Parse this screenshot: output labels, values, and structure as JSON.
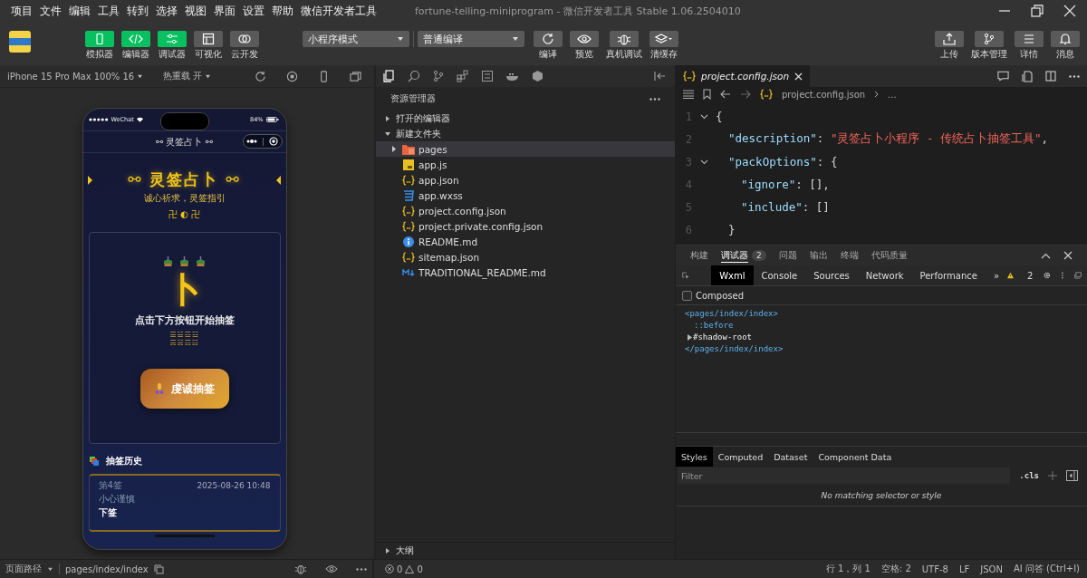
{
  "window": {
    "title": "fortune-telling-miniprogram - 微信开发者工具 Stable 1.06.2504010"
  },
  "menu": [
    "项目",
    "文件",
    "编辑",
    "工具",
    "转到",
    "选择",
    "视图",
    "界面",
    "设置",
    "帮助",
    "微信开发者工具"
  ],
  "toolbar": {
    "view_toggles": [
      {
        "label": "模拟器",
        "kind": "phone",
        "on": true
      },
      {
        "label": "编辑器",
        "kind": "code",
        "on": true
      },
      {
        "label": "调试器",
        "kind": "sliders",
        "on": true
      },
      {
        "label": "可视化",
        "kind": "layout",
        "on": false
      },
      {
        "label": "云开发",
        "kind": "cloud",
        "on": false
      }
    ],
    "mode_select": "小程序模式",
    "compile_select": "普通编译",
    "actions": [
      {
        "label": "编译",
        "kind": "refresh"
      },
      {
        "label": "预览",
        "kind": "eye"
      },
      {
        "label": "真机调试",
        "kind": "bug"
      },
      {
        "label": "清缓存",
        "kind": "layers"
      }
    ],
    "right_actions": [
      {
        "label": "上传",
        "kind": "upload"
      },
      {
        "label": "版本管理",
        "kind": "branch"
      },
      {
        "label": "详情",
        "kind": "menu"
      },
      {
        "label": "消息",
        "kind": "bell"
      }
    ]
  },
  "simulator": {
    "device": "iPhone 15 Pro Max 100% 16",
    "hot_reload": "热重载 开",
    "phone": {
      "carrier": "WeChat",
      "battery": "84%",
      "nav_title": "⚯ 灵签占卜 ⚯",
      "title": "⚯ 灵签占卜 ⚯",
      "subtitle": "诚心祈求，灵签指引",
      "symbols": "卍 ◐ 卍",
      "glyph": "卜",
      "prompt": "点击下方按钮开始抽签",
      "trigrams": [
        "☰☱☲☳",
        "☴☵☶☷"
      ],
      "draw_button": "虔诚抽签",
      "history_title": "抽签历史",
      "history": [
        {
          "number": "第4签",
          "time": "2025-08-26 10:48",
          "meaning": "小心谨慎",
          "grade": "下签"
        }
      ]
    }
  },
  "explorer": {
    "title": "资源管理器",
    "sections": [
      {
        "label": "打开的编辑器",
        "expanded": false
      },
      {
        "label": "新建文件夹",
        "expanded": true,
        "children": [
          {
            "name": "pages",
            "kind": "folder",
            "expanded": false,
            "selected": true
          },
          {
            "name": "app.js",
            "kind": "js",
            "selected": false
          },
          {
            "name": "app.json",
            "kind": "json",
            "selected": false
          },
          {
            "name": "app.wxss",
            "kind": "css",
            "selected": false
          },
          {
            "name": "project.config.json",
            "kind": "json",
            "selected": false
          },
          {
            "name": "project.private.config.json",
            "kind": "json",
            "selected": false
          },
          {
            "name": "README.md",
            "kind": "info",
            "selected": false
          },
          {
            "name": "sitemap.json",
            "kind": "json",
            "selected": false
          },
          {
            "name": "TRADITIONAL_README.md",
            "kind": "md",
            "selected": false
          }
        ]
      }
    ],
    "outline": {
      "label": "大纲",
      "expanded": false
    },
    "errors": "0",
    "warnings": "0"
  },
  "editor": {
    "tab": "project.config.json",
    "breadcrumb": "project.config.json",
    "breadcrumb_more": "...",
    "lines": [
      {
        "number": "1",
        "segments": [
          {
            "kind": "punct",
            "text": "{"
          }
        ],
        "children": [
          {
            "number": "2",
            "segments": [
              {
                "kind": "key",
                "text": "\"description\""
              },
              {
                "kind": "punct",
                "text": ": "
              },
              {
                "kind": "string",
                "text": "\"灵签占卜小程序 - 传统占卜抽签工具\""
              },
              {
                "kind": "punct",
                "text": ","
              }
            ]
          },
          {
            "number": "3",
            "segments": [
              {
                "kind": "key",
                "text": "\"packOptions\""
              },
              {
                "kind": "punct",
                "text": ": {"
              }
            ],
            "children": [
              {
                "number": "4",
                "segments": [
                  {
                    "kind": "key",
                    "text": "\"ignore\""
                  },
                  {
                    "kind": "punct",
                    "text": ": [],"
                  }
                ]
              },
              {
                "number": "5",
                "segments": [
                  {
                    "kind": "key",
                    "text": "\"include\""
                  },
                  {
                    "kind": "punct",
                    "text": ": []"
                  }
                ]
              }
            ]
          },
          {
            "number": "6",
            "segments": [
              {
                "kind": "punct",
                "text": "}"
              }
            ]
          }
        ]
      }
    ]
  },
  "debug_panel": {
    "tabs": [
      {
        "label": "构建",
        "selected": false
      },
      {
        "label": "调试器",
        "selected": true,
        "badge": "2"
      },
      {
        "label": "问题",
        "selected": false
      },
      {
        "label": "输出",
        "selected": false
      },
      {
        "label": "终端",
        "selected": false
      },
      {
        "label": "代码质量",
        "selected": false
      }
    ],
    "devtools_tabs": [
      {
        "label": "Wxml",
        "selected": true
      },
      {
        "label": "Console",
        "selected": false
      },
      {
        "label": "Sources",
        "selected": false
      },
      {
        "label": "Network",
        "selected": false
      },
      {
        "label": "Performance",
        "selected": false
      }
    ],
    "more_tabs": "»",
    "warning_count": "2",
    "composed": {
      "label": "Composed",
      "checked": false
    },
    "tree": {
      "open_tag": "<pages/index/index>",
      "close_tag": "</pages/index/index>",
      "children": [
        {
          "kind": "pseudo",
          "text": "::before"
        },
        {
          "kind": "shadow",
          "text": "#shadow-root",
          "expanded": false
        }
      ]
    },
    "style_tabs": [
      {
        "label": "Styles",
        "selected": true
      },
      {
        "label": "Computed",
        "selected": false
      },
      {
        "label": "Dataset",
        "selected": false
      },
      {
        "label": "Component Data",
        "selected": false
      }
    ],
    "filter_placeholder": "Filter",
    "cls": ".cls",
    "empty_message": "No matching selector or style"
  },
  "status_bar": {
    "page_path_label": "页面路径",
    "page_path": "pages/index/index",
    "items": [
      "行 1，列 1",
      "空格: 2",
      "UTF-8",
      "LF",
      "JSON",
      "AI 问答 (Ctrl+I)"
    ]
  }
}
